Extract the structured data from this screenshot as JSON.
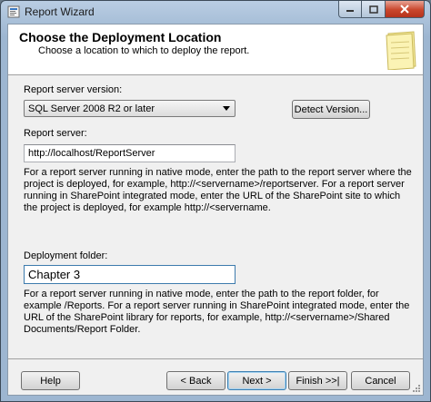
{
  "window": {
    "title": "Report Wizard"
  },
  "header": {
    "title": "Choose the Deployment Location",
    "subtitle": "Choose a location to which to deploy the report."
  },
  "server_version": {
    "label": "Report server version:",
    "selected": "SQL Server 2008 R2 or later",
    "detect_button": "Detect Version..."
  },
  "report_server": {
    "label": "Report server:",
    "value": "http://localhost/ReportServer",
    "help_lines": [
      "For a report server running in native mode, enter the path to the report server where the",
      "project is deployed, for example, http://<servername>/reportserver. For a report server",
      "running in SharePoint integrated mode, enter the URL of the SharePoint site to which",
      "the project is deployed, for example http://<servername."
    ]
  },
  "deployment_folder": {
    "label": "Deployment folder:",
    "value": "Chapter 3",
    "help_lines": [
      "For a report server running in native mode, enter the path to the report folder, for",
      "example /Reports. For a report server running in SharePoint integrated mode, enter the",
      "URL of the SharePoint library for reports, for example, http://<servername>/Shared",
      "Documents/Report Folder."
    ]
  },
  "buttons": {
    "help": "Help",
    "back": "< Back",
    "next": "Next >",
    "finish": "Finish >>|",
    "cancel": "Cancel"
  }
}
